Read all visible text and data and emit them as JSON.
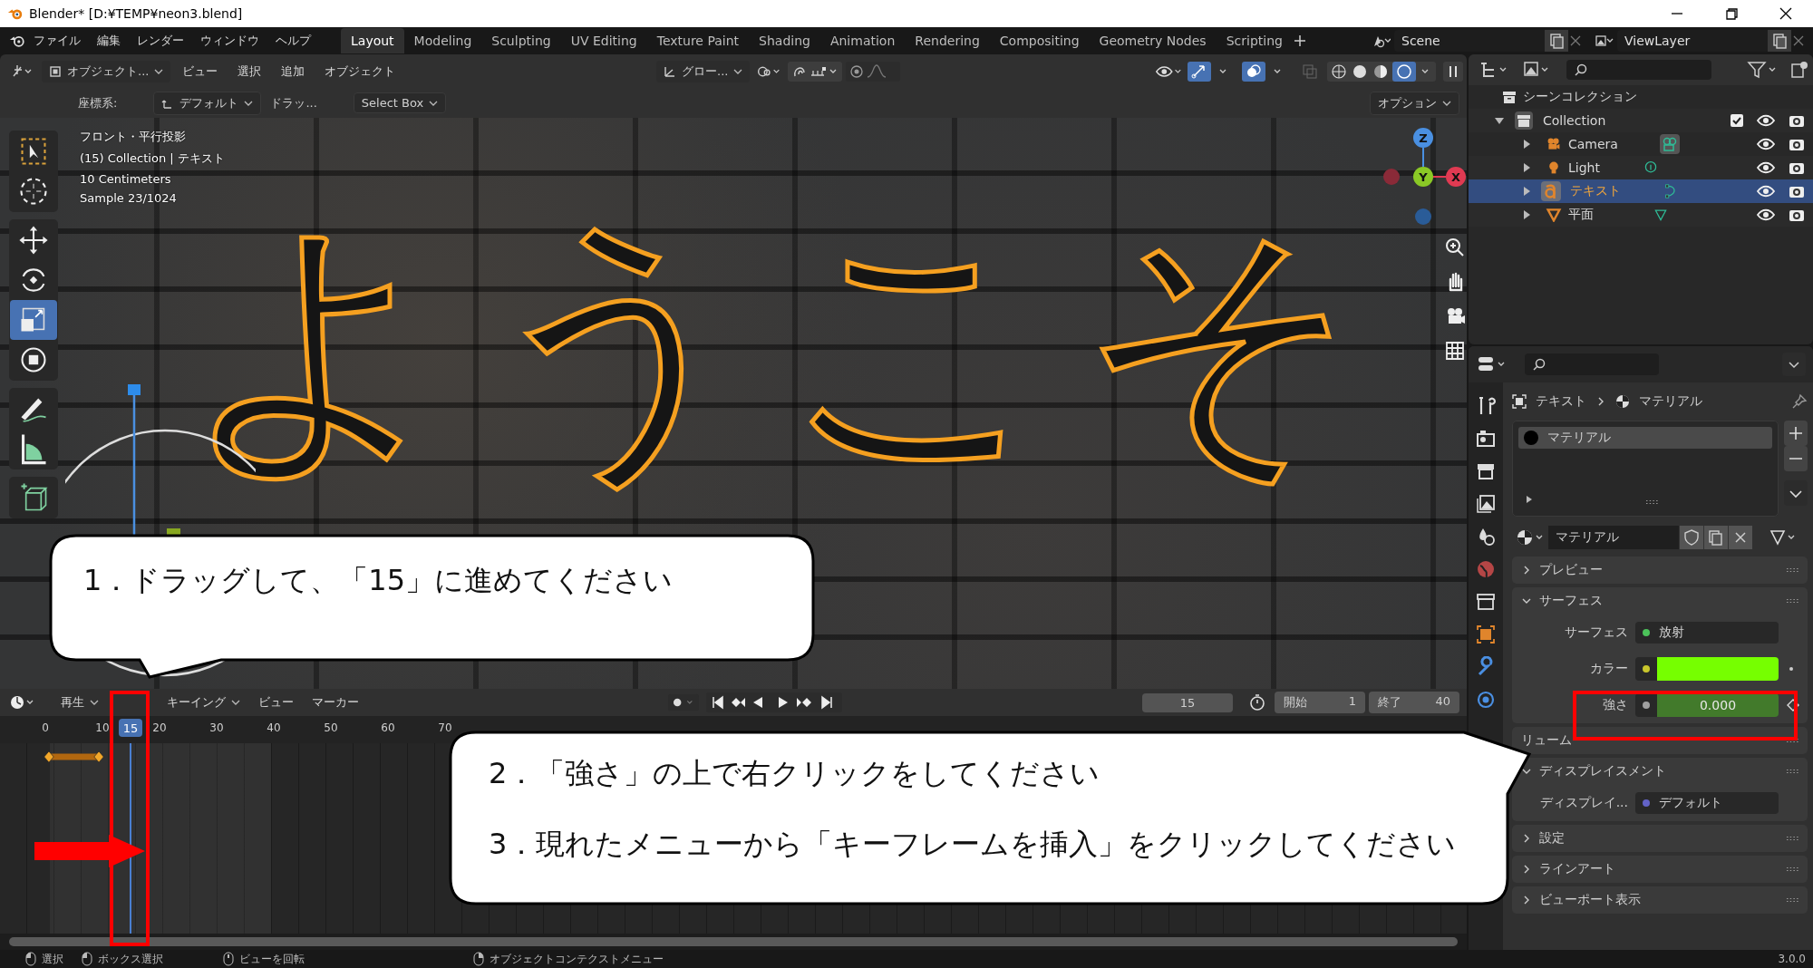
{
  "window": {
    "title": "Blender* [D:¥TEMP¥neon3.blend]"
  },
  "menu": [
    "ファイル",
    "編集",
    "レンダー",
    "ウィンドウ",
    "ヘルプ"
  ],
  "workspaces": [
    {
      "label": "Layout",
      "selected": true
    },
    {
      "label": "Modeling",
      "selected": false
    },
    {
      "label": "Sculpting",
      "selected": false
    },
    {
      "label": "UV Editing",
      "selected": false
    },
    {
      "label": "Texture Paint",
      "selected": false
    },
    {
      "label": "Shading",
      "selected": false
    },
    {
      "label": "Animation",
      "selected": false
    },
    {
      "label": "Rendering",
      "selected": false
    },
    {
      "label": "Compositing",
      "selected": false
    },
    {
      "label": "Geometry Nodes",
      "selected": false
    },
    {
      "label": "Scripting",
      "selected": false
    }
  ],
  "scene": "Scene",
  "view_layer": "ViewLayer",
  "viewport": {
    "mode": "オブジェクト...",
    "menus": [
      "ビュー",
      "選択",
      "追加",
      "オブジェクト"
    ],
    "orientation": "グロー...",
    "tool_settings": {
      "label": "座標系:",
      "pivot": "デフォルト",
      "drag": "ドラッ...",
      "select": "Select Box",
      "options": "オプション"
    },
    "overlay_lines": [
      "フロント・平行投影",
      "(15) Collection | テキスト",
      "10 Centimeters",
      "Sample 23/1024"
    ],
    "gizmo_axes": [
      "Z",
      "Y",
      "X"
    ],
    "scene_text": "ようこそ"
  },
  "timeline": {
    "menus": [
      "再生",
      "キーイング",
      "ビュー",
      "マーカー"
    ],
    "current_frame": "15",
    "playhead_label": "15",
    "start_label": "開始",
    "start": "1",
    "end_label": "終了",
    "end": "40",
    "ruler": [
      "0",
      "10",
      "20",
      "30",
      "40",
      "50",
      "60",
      "70"
    ]
  },
  "outliner": {
    "root": "シーンコレクション",
    "items": [
      {
        "name": "Collection",
        "kind": "collection",
        "expanded": true,
        "checked": true,
        "selected": false,
        "children": [
          {
            "name": "Camera",
            "kind": "camera",
            "selected": false
          },
          {
            "name": "Light",
            "kind": "light",
            "selected": false
          },
          {
            "name": "テキスト",
            "kind": "text",
            "selected": true
          },
          {
            "name": "平面",
            "kind": "mesh",
            "selected": false
          }
        ]
      }
    ]
  },
  "properties": {
    "breadcrumb": [
      "テキスト",
      "マテリアル"
    ],
    "slots": [
      {
        "name": "マテリアル",
        "selected": true
      }
    ],
    "material": "マテリアル",
    "panels": [
      {
        "title": "プレビュー",
        "expanded": false
      },
      {
        "title": "サーフェス",
        "expanded": true,
        "rows": [
          {
            "kind": "link",
            "label": "サーフェス",
            "value": "放射",
            "color": "#4cc35a"
          },
          {
            "kind": "swatch",
            "label": "カラー",
            "color": "#76ff00"
          },
          {
            "kind": "number",
            "label": "強さ",
            "value": "0.000",
            "keyframed": true
          }
        ]
      },
      {
        "title": "リューム"
      },
      {
        "title": "ディスプレイスメント",
        "expanded": true,
        "rows": [
          {
            "kind": "link",
            "label": "ディスプレイ...",
            "value": "デフォルト",
            "color": "#6363c7"
          }
        ]
      },
      {
        "title": "設定",
        "expanded": false
      },
      {
        "title": "ラインアート",
        "expanded": false
      },
      {
        "title": "ビューポート表示",
        "expanded": false
      }
    ]
  },
  "status_bar": {
    "items": [
      "選択",
      "ボックス選択",
      "ビューを回転",
      "オブジェクトコンテクストメニュー"
    ],
    "version": "3.0.0"
  },
  "callouts": [
    {
      "lines": [
        "1．ドラッグして、「15」に進めてください"
      ]
    },
    {
      "lines": [
        "2．「強さ」の上で右クリックをしてください",
        "3．現れたメニューから「キーフレームを挿入」をクリックしてください"
      ]
    }
  ]
}
